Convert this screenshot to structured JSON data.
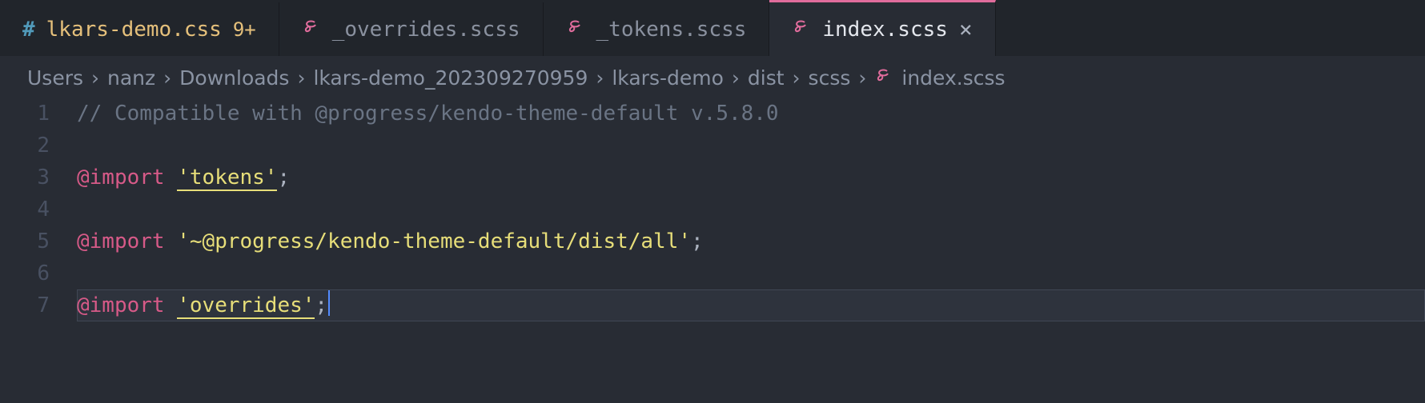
{
  "tabs": [
    {
      "icon": "hash",
      "label": "lkars-demo.css",
      "badge": "9+",
      "modified": true,
      "active": false
    },
    {
      "icon": "scss",
      "label": "_overrides.scss",
      "badge": "",
      "modified": false,
      "active": false
    },
    {
      "icon": "scss",
      "label": "_tokens.scss",
      "badge": "",
      "modified": false,
      "active": false
    },
    {
      "icon": "scss",
      "label": "index.scss",
      "badge": "",
      "modified": false,
      "active": true,
      "close": "×"
    }
  ],
  "breadcrumb": {
    "segments": [
      "Users",
      "nanz",
      "Downloads",
      "lkars-demo_202309270959",
      "lkars-demo",
      "dist",
      "scss"
    ],
    "file_icon": "scss",
    "file": "index.scss"
  },
  "code": {
    "line_numbers": [
      "1",
      "2",
      "3",
      "4",
      "5",
      "6",
      "7"
    ],
    "comment": "// Compatible with @progress/kendo-theme-default v.5.8.0",
    "import_kw": "@import",
    "l3_string": "'tokens'",
    "l5_string": "'~@progress/kendo-theme-default/dist/all'",
    "l7_string": "'overrides'",
    "semi": ";"
  }
}
